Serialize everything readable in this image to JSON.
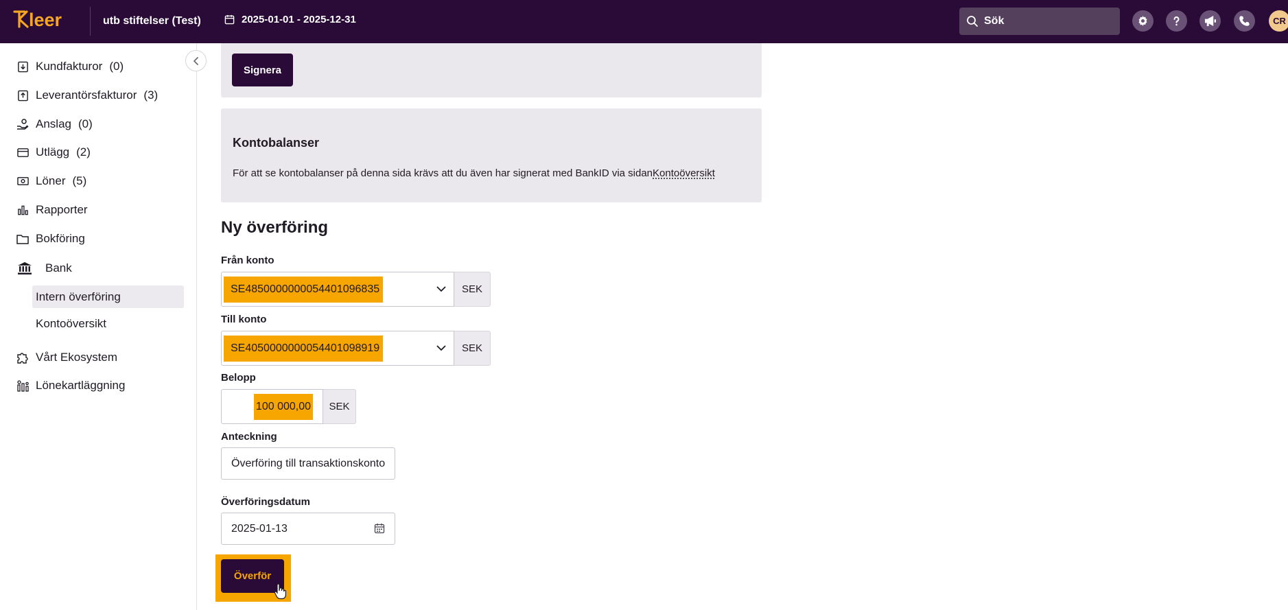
{
  "header": {
    "logo_text": "Kleer",
    "org_name": "utb stiftelser (Test)",
    "period": "2025-01-01 - 2025-12-31",
    "search_placeholder": "Sök",
    "avatar_initials": "CR",
    "icons": [
      "gear-icon",
      "help-icon",
      "megaphone-icon",
      "phone-icon"
    ]
  },
  "sidebar": {
    "items": [
      {
        "label": "Kundfakturor",
        "count": "(0)",
        "icon": "invoice-in-icon"
      },
      {
        "label": "Leverantörsfakturor",
        "count": "(3)",
        "icon": "invoice-out-icon"
      },
      {
        "label": "Anslag",
        "count": "(0)",
        "icon": "grant-hand-icon"
      },
      {
        "label": "Utlägg",
        "count": "(2)",
        "icon": "card-icon"
      },
      {
        "label": "Löner",
        "count": "(5)",
        "icon": "cash-icon"
      },
      {
        "label": "Rapporter",
        "count": "",
        "icon": "bar-chart-icon"
      },
      {
        "label": "Bokföring",
        "count": "",
        "icon": "folder-icon"
      },
      {
        "label": "Bank",
        "count": "",
        "icon": "bank-icon"
      }
    ],
    "bank_sub": [
      {
        "label": "Intern överföring",
        "active": true
      },
      {
        "label": "Kontoöversikt",
        "active": false
      }
    ],
    "bottom_items": [
      {
        "label": "Vårt Ekosystem",
        "icon": "puzzle-icon"
      },
      {
        "label": "Lönekartläggning",
        "icon": "chart-people-icon"
      }
    ]
  },
  "main": {
    "sign_button": "Signera",
    "balances": {
      "title": "Kontobalanser",
      "text": "För att se kontobalanser på denna sida krävs att du även har signerat med BankID via sidan",
      "link": "Kontoöversikt"
    },
    "form": {
      "title": "Ny överföring",
      "from_label": "Från konto",
      "from_value": "SE4850000000054401096835",
      "from_currency": "SEK",
      "to_label": "Till konto",
      "to_value": "SE4050000000054401098919",
      "to_currency": "SEK",
      "amount_label": "Belopp",
      "amount_value": "100 000,00",
      "amount_currency": "SEK",
      "note_label": "Anteckning",
      "note_value": "Överföring till transaktionskonto",
      "date_label": "Överföringsdatum",
      "date_value": "2025-01-13",
      "submit": "Överför"
    }
  },
  "colors": {
    "topbar": "#2a0a36",
    "accent": "#f7a600",
    "card_bg": "#ebe8ed"
  }
}
